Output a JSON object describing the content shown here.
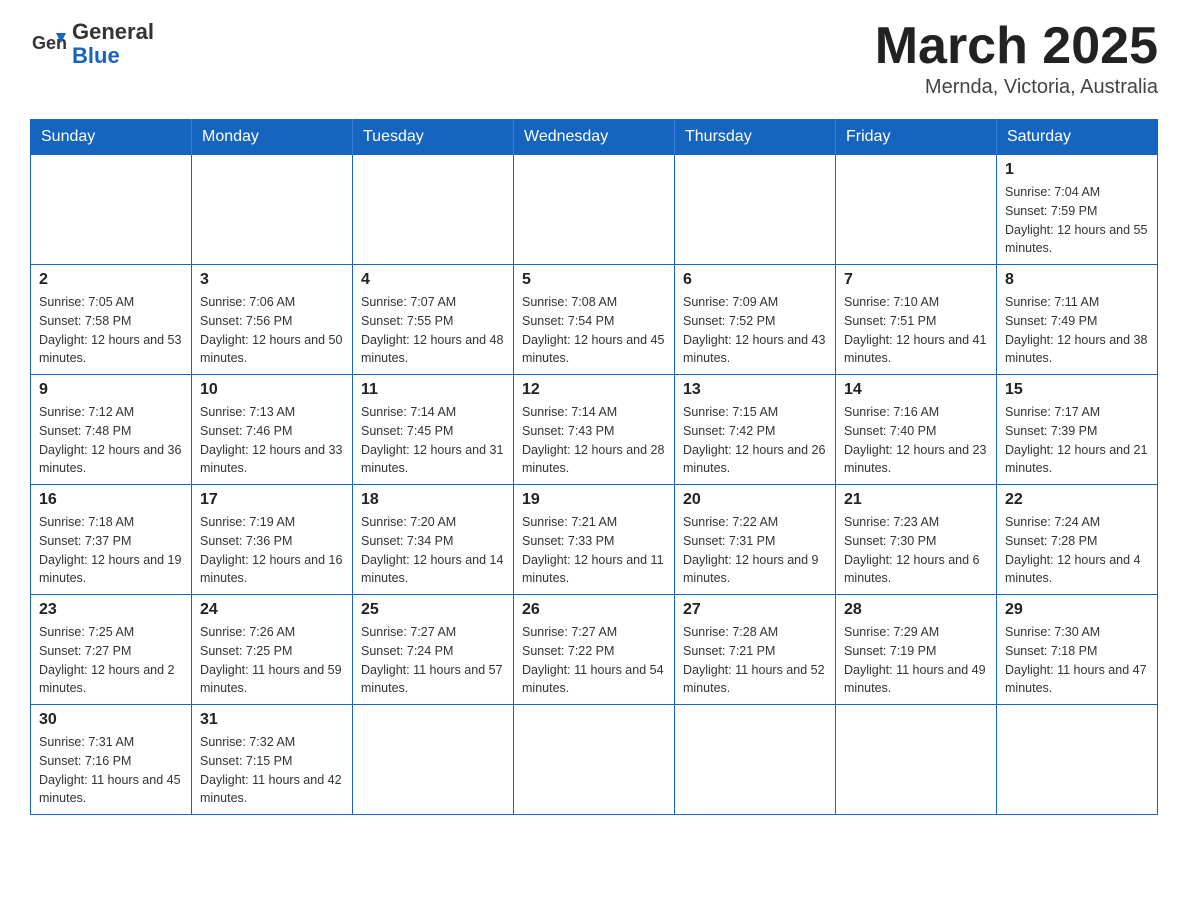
{
  "header": {
    "logo_general": "General",
    "logo_blue": "Blue",
    "month_title": "March 2025",
    "location": "Mernda, Victoria, Australia"
  },
  "weekdays": [
    "Sunday",
    "Monday",
    "Tuesday",
    "Wednesday",
    "Thursday",
    "Friday",
    "Saturday"
  ],
  "weeks": [
    [
      {
        "day": "",
        "info": ""
      },
      {
        "day": "",
        "info": ""
      },
      {
        "day": "",
        "info": ""
      },
      {
        "day": "",
        "info": ""
      },
      {
        "day": "",
        "info": ""
      },
      {
        "day": "",
        "info": ""
      },
      {
        "day": "1",
        "info": "Sunrise: 7:04 AM\nSunset: 7:59 PM\nDaylight: 12 hours and 55 minutes."
      }
    ],
    [
      {
        "day": "2",
        "info": "Sunrise: 7:05 AM\nSunset: 7:58 PM\nDaylight: 12 hours and 53 minutes."
      },
      {
        "day": "3",
        "info": "Sunrise: 7:06 AM\nSunset: 7:56 PM\nDaylight: 12 hours and 50 minutes."
      },
      {
        "day": "4",
        "info": "Sunrise: 7:07 AM\nSunset: 7:55 PM\nDaylight: 12 hours and 48 minutes."
      },
      {
        "day": "5",
        "info": "Sunrise: 7:08 AM\nSunset: 7:54 PM\nDaylight: 12 hours and 45 minutes."
      },
      {
        "day": "6",
        "info": "Sunrise: 7:09 AM\nSunset: 7:52 PM\nDaylight: 12 hours and 43 minutes."
      },
      {
        "day": "7",
        "info": "Sunrise: 7:10 AM\nSunset: 7:51 PM\nDaylight: 12 hours and 41 minutes."
      },
      {
        "day": "8",
        "info": "Sunrise: 7:11 AM\nSunset: 7:49 PM\nDaylight: 12 hours and 38 minutes."
      }
    ],
    [
      {
        "day": "9",
        "info": "Sunrise: 7:12 AM\nSunset: 7:48 PM\nDaylight: 12 hours and 36 minutes."
      },
      {
        "day": "10",
        "info": "Sunrise: 7:13 AM\nSunset: 7:46 PM\nDaylight: 12 hours and 33 minutes."
      },
      {
        "day": "11",
        "info": "Sunrise: 7:14 AM\nSunset: 7:45 PM\nDaylight: 12 hours and 31 minutes."
      },
      {
        "day": "12",
        "info": "Sunrise: 7:14 AM\nSunset: 7:43 PM\nDaylight: 12 hours and 28 minutes."
      },
      {
        "day": "13",
        "info": "Sunrise: 7:15 AM\nSunset: 7:42 PM\nDaylight: 12 hours and 26 minutes."
      },
      {
        "day": "14",
        "info": "Sunrise: 7:16 AM\nSunset: 7:40 PM\nDaylight: 12 hours and 23 minutes."
      },
      {
        "day": "15",
        "info": "Sunrise: 7:17 AM\nSunset: 7:39 PM\nDaylight: 12 hours and 21 minutes."
      }
    ],
    [
      {
        "day": "16",
        "info": "Sunrise: 7:18 AM\nSunset: 7:37 PM\nDaylight: 12 hours and 19 minutes."
      },
      {
        "day": "17",
        "info": "Sunrise: 7:19 AM\nSunset: 7:36 PM\nDaylight: 12 hours and 16 minutes."
      },
      {
        "day": "18",
        "info": "Sunrise: 7:20 AM\nSunset: 7:34 PM\nDaylight: 12 hours and 14 minutes."
      },
      {
        "day": "19",
        "info": "Sunrise: 7:21 AM\nSunset: 7:33 PM\nDaylight: 12 hours and 11 minutes."
      },
      {
        "day": "20",
        "info": "Sunrise: 7:22 AM\nSunset: 7:31 PM\nDaylight: 12 hours and 9 minutes."
      },
      {
        "day": "21",
        "info": "Sunrise: 7:23 AM\nSunset: 7:30 PM\nDaylight: 12 hours and 6 minutes."
      },
      {
        "day": "22",
        "info": "Sunrise: 7:24 AM\nSunset: 7:28 PM\nDaylight: 12 hours and 4 minutes."
      }
    ],
    [
      {
        "day": "23",
        "info": "Sunrise: 7:25 AM\nSunset: 7:27 PM\nDaylight: 12 hours and 2 minutes."
      },
      {
        "day": "24",
        "info": "Sunrise: 7:26 AM\nSunset: 7:25 PM\nDaylight: 11 hours and 59 minutes."
      },
      {
        "day": "25",
        "info": "Sunrise: 7:27 AM\nSunset: 7:24 PM\nDaylight: 11 hours and 57 minutes."
      },
      {
        "day": "26",
        "info": "Sunrise: 7:27 AM\nSunset: 7:22 PM\nDaylight: 11 hours and 54 minutes."
      },
      {
        "day": "27",
        "info": "Sunrise: 7:28 AM\nSunset: 7:21 PM\nDaylight: 11 hours and 52 minutes."
      },
      {
        "day": "28",
        "info": "Sunrise: 7:29 AM\nSunset: 7:19 PM\nDaylight: 11 hours and 49 minutes."
      },
      {
        "day": "29",
        "info": "Sunrise: 7:30 AM\nSunset: 7:18 PM\nDaylight: 11 hours and 47 minutes."
      }
    ],
    [
      {
        "day": "30",
        "info": "Sunrise: 7:31 AM\nSunset: 7:16 PM\nDaylight: 11 hours and 45 minutes."
      },
      {
        "day": "31",
        "info": "Sunrise: 7:32 AM\nSunset: 7:15 PM\nDaylight: 11 hours and 42 minutes."
      },
      {
        "day": "",
        "info": ""
      },
      {
        "day": "",
        "info": ""
      },
      {
        "day": "",
        "info": ""
      },
      {
        "day": "",
        "info": ""
      },
      {
        "day": "",
        "info": ""
      }
    ]
  ]
}
